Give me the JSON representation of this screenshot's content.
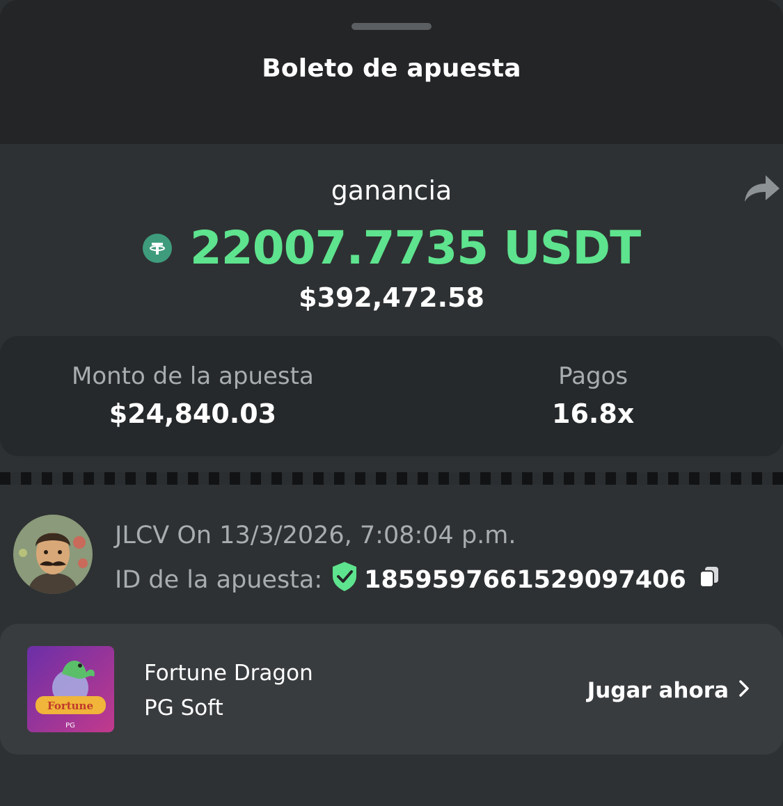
{
  "header": {
    "title": "Boleto de apuesta"
  },
  "win": {
    "label": "ganancia",
    "amount": "22007.7735 USDT",
    "usd": "$392,472.58",
    "currency_icon": "tether-icon"
  },
  "stats": {
    "bet_label": "Monto de la apuesta",
    "bet_value": "$24,840.03",
    "payout_label": "Pagos",
    "payout_value": "16.8x"
  },
  "bet_info": {
    "user_line": "JLCV On 13/3/2026, 7:08:04 p.m.",
    "id_label": "ID de la apuesta:",
    "id_value": "1859597661529097406"
  },
  "game": {
    "name": "Fortune Dragon",
    "provider": "PG Soft",
    "play_label": "Jugar ahora",
    "thumb_text": "Fortune Dragon",
    "thumb_badge": "PG"
  },
  "colors": {
    "accent_green": "#5ee38e",
    "tether_green": "#3e9c7c",
    "header_bg": "#232526",
    "body_bg": "#2e3133",
    "card_bg": "#393c3f"
  }
}
